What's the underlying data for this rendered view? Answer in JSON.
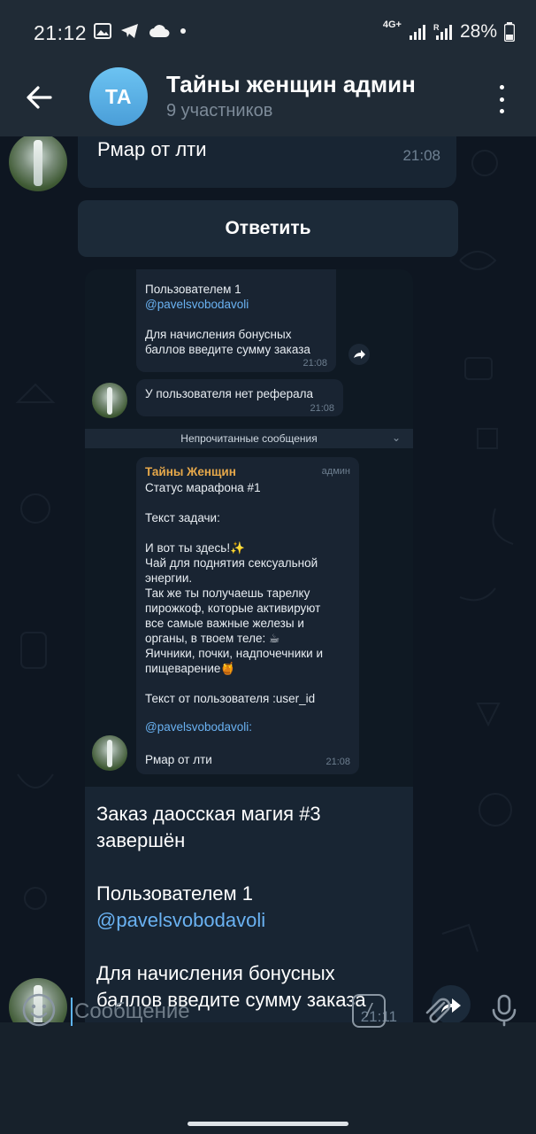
{
  "status_bar": {
    "time": "21:12",
    "network": "4G+",
    "battery": "28%",
    "icons_left": [
      "gallery-icon",
      "telegram-icon",
      "cloud-icon",
      "dot-icon"
    ],
    "icons_right": [
      "signal-icon",
      "signal-r-icon",
      "battery-icon"
    ]
  },
  "header": {
    "avatar_initials": "TA",
    "title": "Тайны женщин админ",
    "subtitle": "9 участников",
    "accent_color": "#5aaee6"
  },
  "messages": {
    "first": {
      "text": "Рмар от лти",
      "time": "21:08"
    },
    "reply_button": "Ответить",
    "screenshot": {
      "msg1_line1": "Пользователем 1",
      "msg1_link": "@pavelsvobodavoli",
      "msg1_line3": "Для начисления бонусных",
      "msg1_line4": "баллов введите сумму заказа",
      "msg1_time": "21:08",
      "msg2_text": "У пользователя нет реферала",
      "msg2_time": "21:08",
      "unread_label": "Непрочитанные сообщения",
      "msg3_sender": "Тайны Женщин",
      "msg3_role": "админ",
      "msg3_lines": [
        "Статус марафона #1",
        "",
        "Текст задачи:",
        "",
        "И вот ты здесь!✨",
        "Чай для поднятия сексуальной",
        "энергии.",
        "Так же ты получаешь тарелку",
        "пирожкоф, которые активируют",
        "все самые важные железы и",
        "органы, в твоем теле: ☕",
        "Яичники, почки, надпочечники и",
        "пищеварение🍯",
        "",
        "Текст от пользователя :user_id"
      ],
      "msg3_link": "@pavelsvobodavoli:",
      "msg3_last": "Рмар от лти",
      "msg3_time": "21:08"
    },
    "last": {
      "line1": "Заказ даосская магия #3",
      "line2": "завершён",
      "line3": "Пользователем 1",
      "link": "@pavelsvobodavoli",
      "line4": "Для начисления бонусных",
      "line5": "баллов введите сумму заказа",
      "time": "21:11"
    }
  },
  "composer": {
    "placeholder": "Сообщение",
    "cmd_symbol": "/"
  }
}
